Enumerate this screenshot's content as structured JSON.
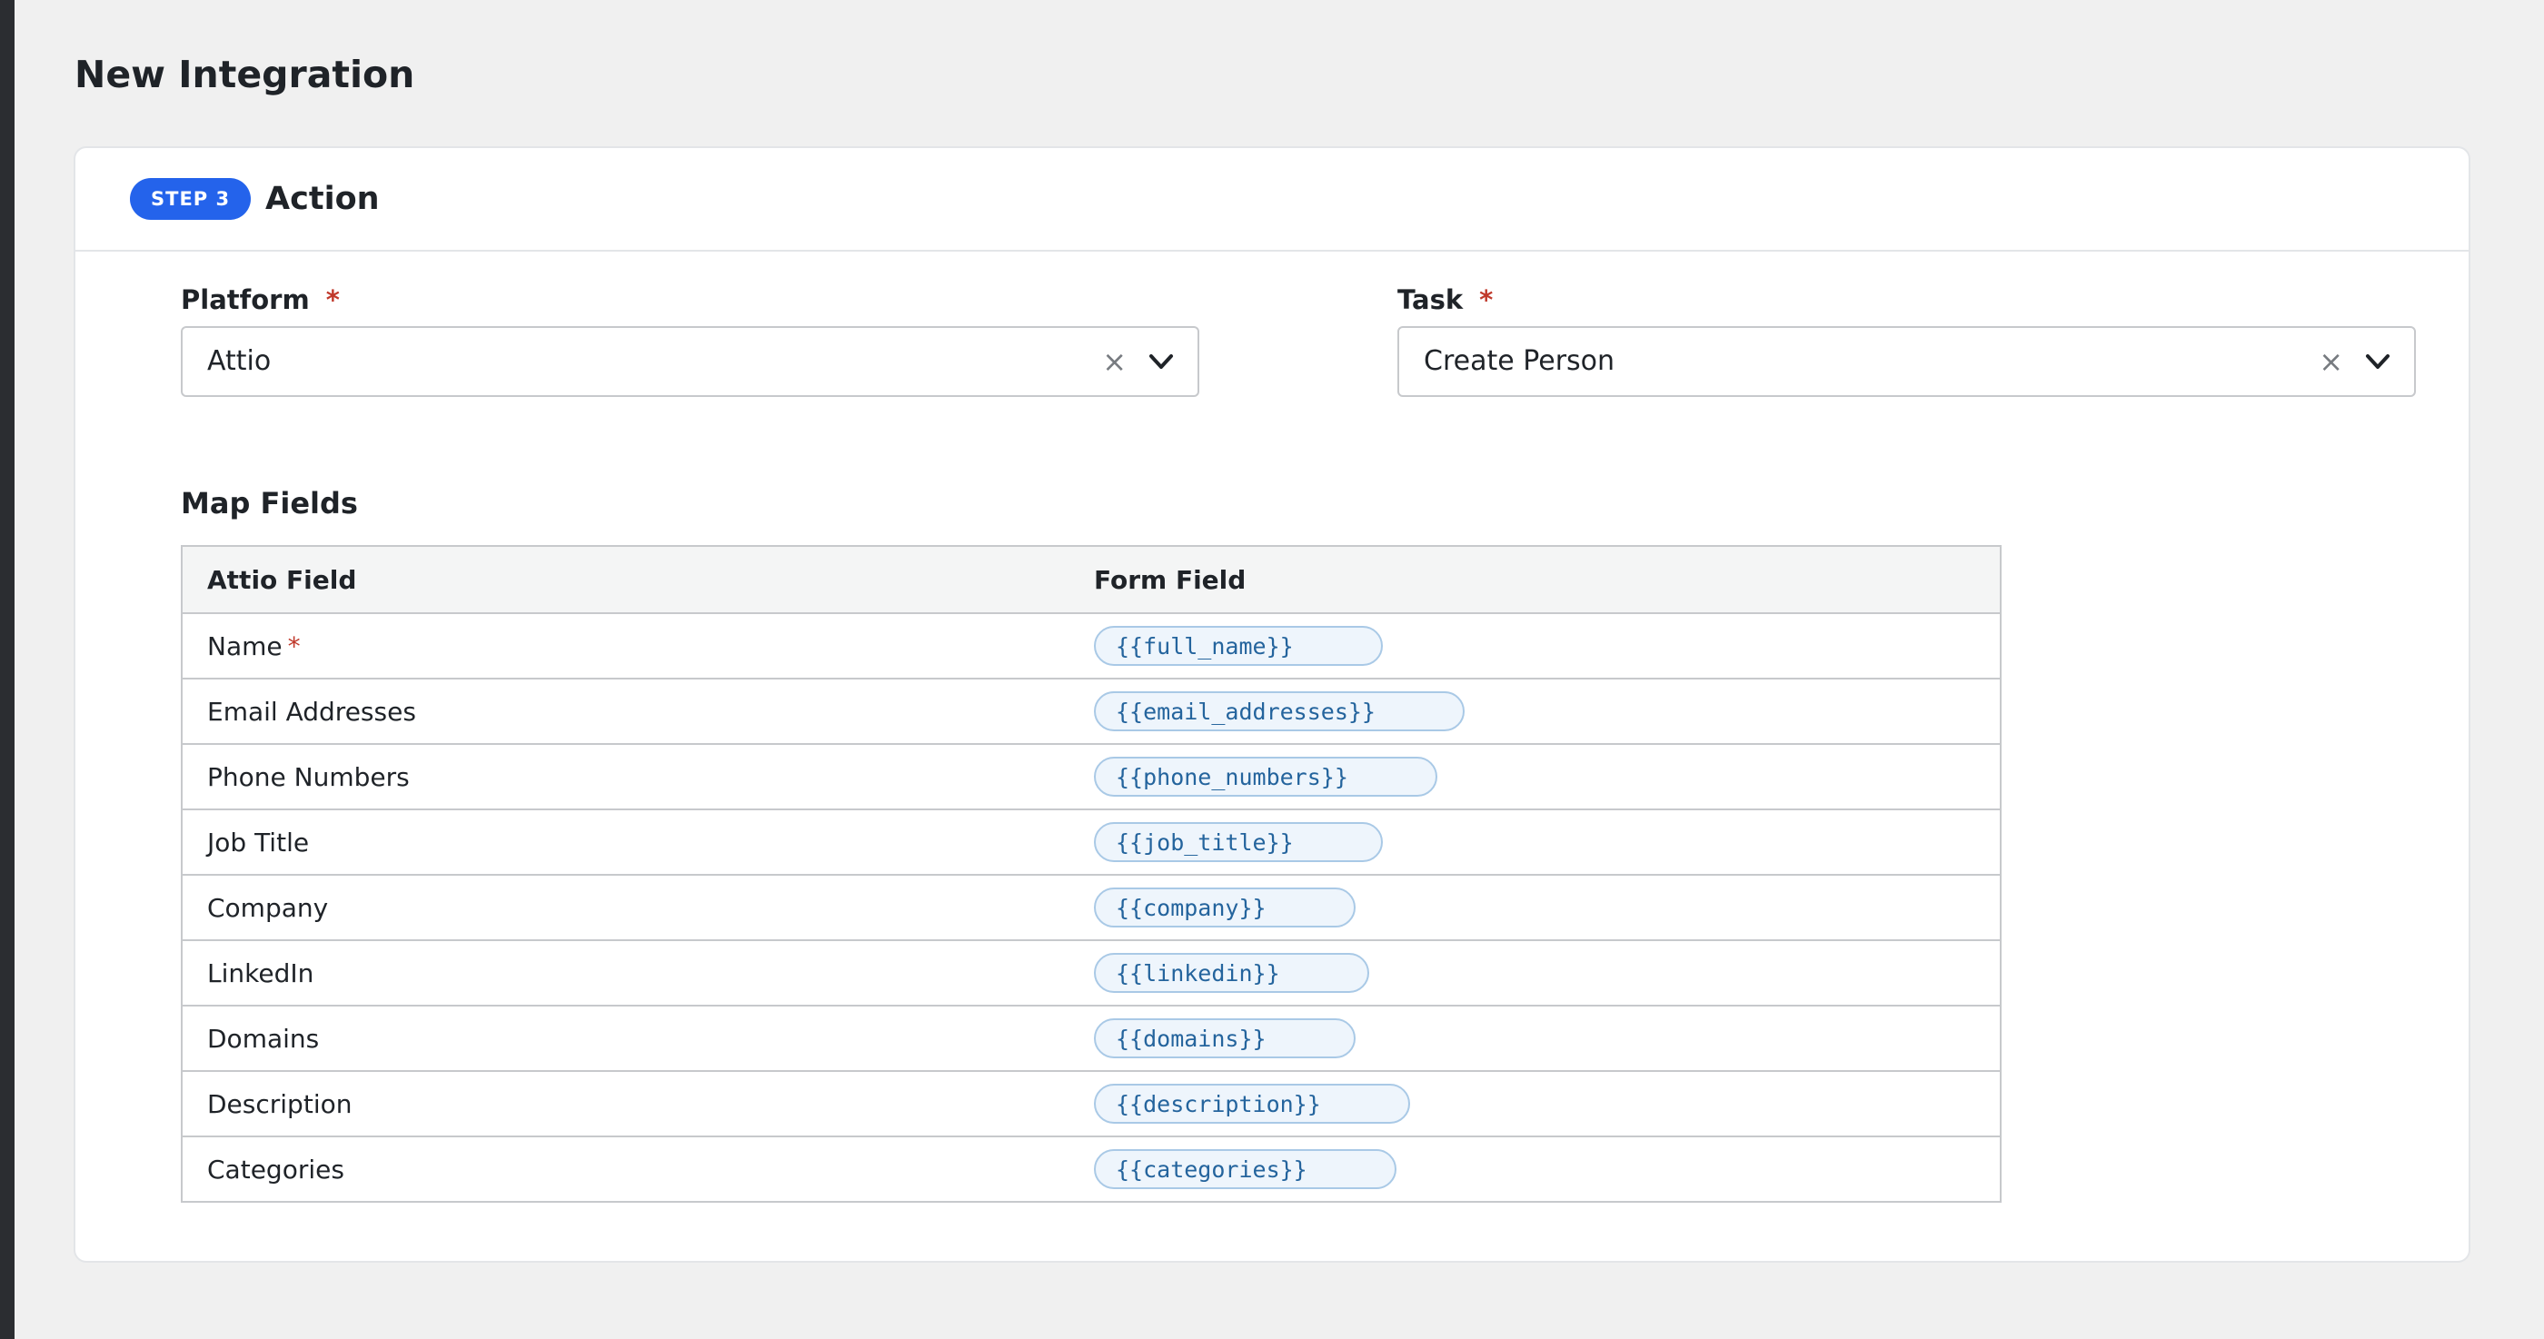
{
  "page": {
    "title": "New Integration"
  },
  "step": {
    "badge": "STEP 3",
    "title": "Action"
  },
  "platform": {
    "label": "Platform",
    "required": "*",
    "value": "Attio",
    "clear": "×"
  },
  "task": {
    "label": "Task",
    "required": "*",
    "value": "Create Person",
    "clear": "×"
  },
  "map_fields": {
    "title": "Map Fields",
    "headers": {
      "left": "Attio Field",
      "right": "Form Field"
    },
    "rows": [
      {
        "field": "Name",
        "required": "*",
        "token": "{{full_name}}"
      },
      {
        "field": "Email Addresses",
        "token": "{{email_addresses}}"
      },
      {
        "field": "Phone Numbers",
        "token": "{{phone_numbers}}"
      },
      {
        "field": "Job Title",
        "token": "{{job_title}}"
      },
      {
        "field": "Company",
        "token": "{{company}}"
      },
      {
        "field": "LinkedIn",
        "token": "{{linkedin}}"
      },
      {
        "field": "Domains",
        "token": "{{domains}}"
      },
      {
        "field": "Description",
        "token": "{{description}}"
      },
      {
        "field": "Categories",
        "token": "{{categories}}"
      }
    ]
  },
  "colors": {
    "accent": "#2463eb",
    "required": "#c0392b",
    "token_text": "#24649d",
    "token_bg": "#eef5fc"
  },
  "icons": {
    "clear": "close-icon",
    "dropdown": "chevron-down-icon"
  }
}
